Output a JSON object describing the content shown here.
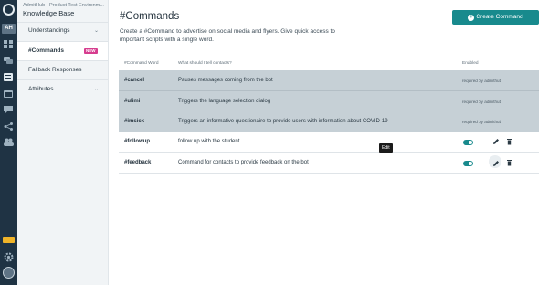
{
  "rail": {
    "logo_icon": "chat-bubble-logo-icon",
    "workspace_badge": "AH",
    "nav_icons": [
      "dashboard-icon",
      "conversations-icon",
      "knowledge-base-icon",
      "calendar-icon",
      "messages-icon",
      "share-icon",
      "contacts-icon"
    ],
    "beta_badge": "",
    "settings_icon": "gear-icon",
    "avatar_initials": "BMM"
  },
  "sidebar": {
    "org_name": "AdmitHub - Product Test Environm...",
    "section_title": "Knowledge Base",
    "items": [
      {
        "label": "Understandings",
        "expandable": true
      },
      {
        "label": "#Commands",
        "badge": "NEW",
        "active": true
      },
      {
        "label": "Fallback Responses"
      },
      {
        "label": "Attributes",
        "expandable": true
      }
    ]
  },
  "main": {
    "title": "#Commands",
    "create_button": "Create Command",
    "description": "Create a #Command to advertise on social media and flyers. Give quick access to important scripts with a single word.",
    "columns": {
      "word": "#Command Word",
      "what": "What should I tell contacts?",
      "enabled": "Enabled"
    },
    "rows": [
      {
        "word": "#cancel",
        "what": "Pauses messages coming from the bot",
        "status": "required by admithub",
        "system": true
      },
      {
        "word": "#ulimi",
        "what": "Triggers the language selection dialog",
        "status": "required by admithub",
        "system": true
      },
      {
        "word": "#imsick",
        "what": "Triggers an informative questionaire to provide users with information about COVID-19",
        "status": "required by admithub",
        "system": true
      },
      {
        "word": "#followup",
        "what": "follow up with the student",
        "enabled": true,
        "system": false
      },
      {
        "word": "#feedback",
        "what": "Command for contacts to provide feedback on the bot",
        "enabled": true,
        "system": false
      }
    ],
    "tooltip": "Edit"
  },
  "colors": {
    "accent": "#188a8d",
    "rail_bg": "#1f3344",
    "system_row_bg": "#c6d0d6",
    "new_badge": "#d63d8f"
  }
}
